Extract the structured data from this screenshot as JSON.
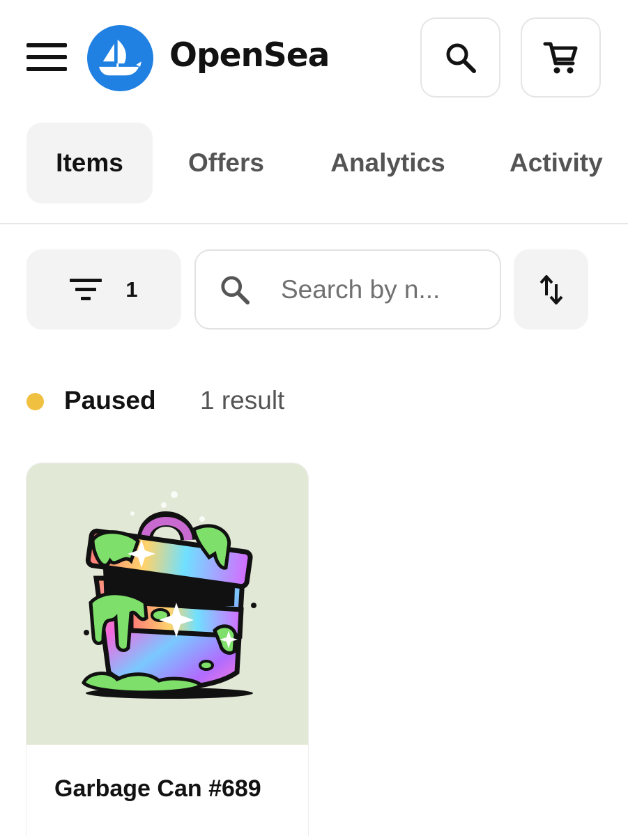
{
  "header": {
    "brand": "OpenSea",
    "menu_icon": "hamburger-menu-icon",
    "logo_icon": "opensea-logo-icon",
    "search_icon": "search-icon",
    "cart_icon": "cart-icon",
    "brand_color": "#2081e2"
  },
  "tabs": [
    {
      "label": "Items",
      "active": true
    },
    {
      "label": "Offers",
      "active": false
    },
    {
      "label": "Analytics",
      "active": false
    },
    {
      "label": "Activity",
      "active": false
    }
  ],
  "toolbar": {
    "filter_icon": "filter-lines-icon",
    "filter_count": "1",
    "search_icon": "search-icon",
    "search_placeholder": "Search by n...",
    "search_value": "",
    "sort_icon": "sort-arrows-icon"
  },
  "status": {
    "label": "Paused",
    "dot_color": "#f0c040",
    "result_count": "1 result"
  },
  "items": [
    {
      "name": "Garbage Can #689",
      "image_icon": "garbage-can-nft-image",
      "image_bg": "#e2e8d6"
    }
  ]
}
